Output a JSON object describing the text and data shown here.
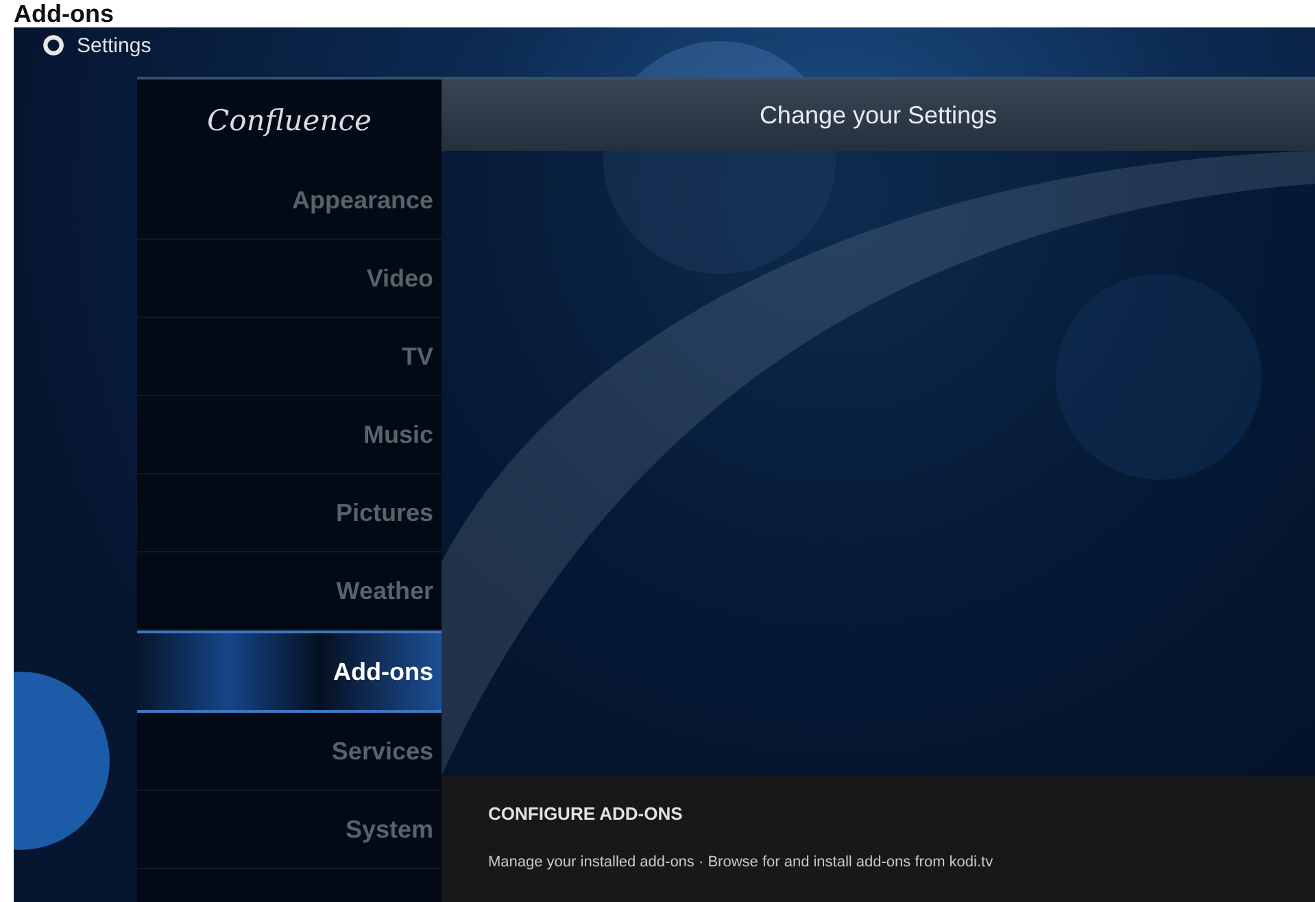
{
  "page_heading": "Add-ons",
  "header": {
    "title": "Settings"
  },
  "skin_logo": "Confluence",
  "menu": [
    {
      "label": "Appearance",
      "selected": false
    },
    {
      "label": "Video",
      "selected": false
    },
    {
      "label": "TV",
      "selected": false
    },
    {
      "label": "Music",
      "selected": false
    },
    {
      "label": "Pictures",
      "selected": false
    },
    {
      "label": "Weather",
      "selected": false
    },
    {
      "label": "Add-ons",
      "selected": true
    },
    {
      "label": "Services",
      "selected": false
    },
    {
      "label": "System",
      "selected": false
    }
  ],
  "content": {
    "title": "Change your Settings",
    "section_heading": "CONFIGURE ADD-ONS",
    "description": "Manage your installed add-ons · Browse for and install add-ons from kodi.tv"
  }
}
